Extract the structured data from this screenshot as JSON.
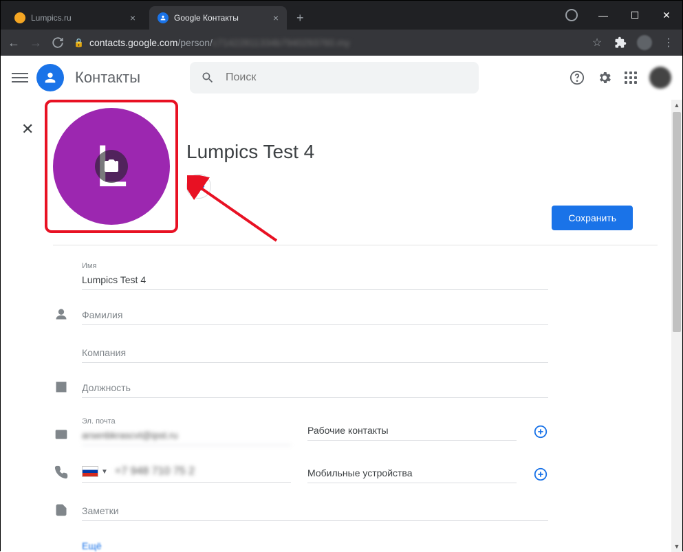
{
  "browser": {
    "tabs": [
      {
        "title": "Lumpics.ru"
      },
      {
        "title": "Google Контакты"
      }
    ],
    "url_domain": "contacts.google.com",
    "url_path": "/person/",
    "url_blurred": "c71422811334b7940293760.my"
  },
  "header": {
    "app_title": "Контакты",
    "search_placeholder": "Поиск"
  },
  "contact": {
    "display_name": "Lumpics Test 4",
    "avatar_letter": "L",
    "save_button": "Сохранить"
  },
  "fields": {
    "name_label": "Имя",
    "name_value": "Lumpics Test 4",
    "surname_placeholder": "Фамилия",
    "company_placeholder": "Компания",
    "position_placeholder": "Должность",
    "email_label": "Эл. почта",
    "email_value": "arsenbkrascvt@ipst.ru",
    "email_type": "Рабочие контакты",
    "phone_value": "+7 948 710 75 2",
    "phone_type": "Мобильные устройства",
    "notes_placeholder": "Заметки",
    "more_link": "Ещё"
  }
}
